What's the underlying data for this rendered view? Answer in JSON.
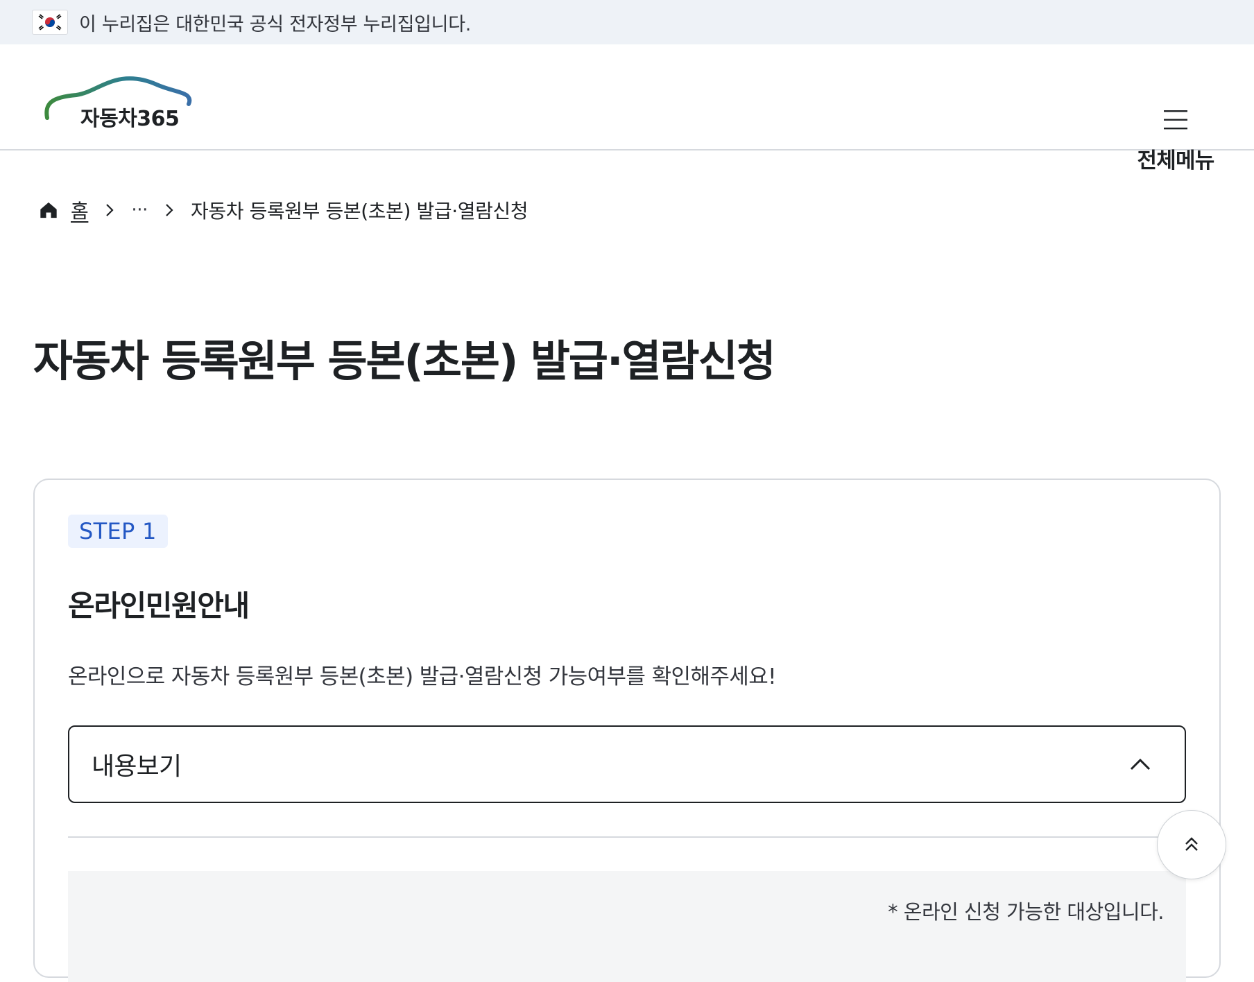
{
  "gov_banner": {
    "flag_icon": "taegeukgi-flag-icon",
    "text": "이 누리집은 대한민국 공식 전자정부 누리집입니다."
  },
  "header": {
    "logo_text": "자동차365",
    "logo_colors": [
      "#3d8a3e",
      "#2e7f8f",
      "#3a6fa8"
    ],
    "menu_icon": "hamburger-icon",
    "menu_label": "전체메뉴"
  },
  "breadcrumb": {
    "home_icon": "home-icon",
    "home_label": "홈",
    "separator_icon": "chevron-right-icon",
    "ellipsis": "···",
    "current": "자동차 등록원부 등본(초본) 발급·열람신청"
  },
  "page_title": "자동차 등록원부 등본(초본) 발급·열람신청",
  "step_card": {
    "badge": "STEP 1",
    "title": "온라인민원안내",
    "description": "온라인으로 자동차 등록원부 등본(초본) 발급·열람신청 가능여부를 확인해주세요!",
    "accordion": {
      "label": "내용보기",
      "icon": "chevron-up-icon"
    },
    "notice": "* 온라인 신청 가능한 대상입니다."
  },
  "back_to_top": {
    "icon": "double-chevron-up-icon"
  },
  "colors": {
    "banner_bg": "#eef2f7",
    "badge_bg": "#ecf2fe",
    "badge_text": "#2458c4",
    "border": "#d6d9de",
    "text": "#1e2124"
  }
}
